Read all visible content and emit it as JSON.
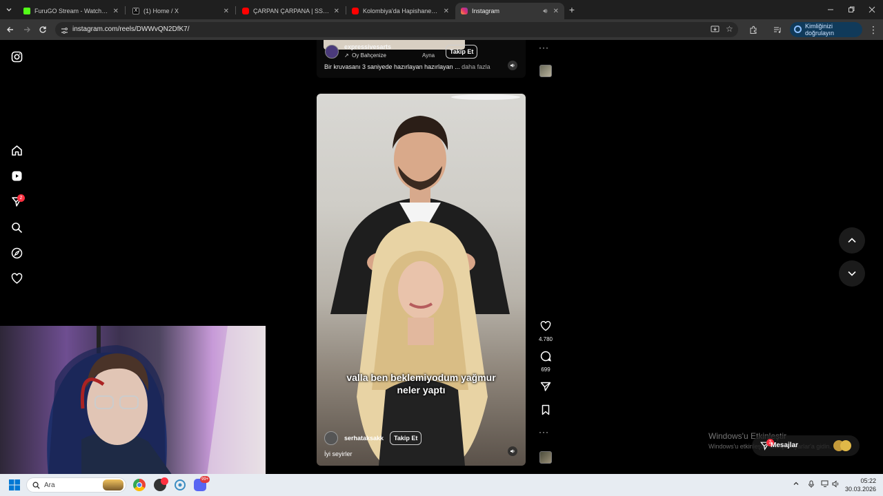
{
  "browser": {
    "tabs": [
      {
        "title": "FuruGO Stream - Watch Live on",
        "color": "#53fc18",
        "active": false
      },
      {
        "title": "(1) Home / X",
        "color": "#000000",
        "active": false
      },
      {
        "title": "ÇARPAN ÇARPANA | SSriders | E",
        "color": "#ff0000",
        "active": false
      },
      {
        "title": "Kolombiya'da Hapishane Baskın",
        "color": "#ff0000",
        "active": false
      },
      {
        "title": "Instagram",
        "color": "#e1306c",
        "active": true
      }
    ],
    "url": "instagram.com/reels/DWWvQN2DfK7/",
    "verify_label": "Kimliğinizi doğrulayın"
  },
  "sidebar": {
    "notification_count": "2"
  },
  "reel_top": {
    "username": "expressivesarts",
    "audio_label": "Oy Bahçenize",
    "audio_label_2": "Ayna",
    "follow_label": "Takip Et",
    "caption": "Bir kruvasanı 3 saniyede hazırlayan hazırlayan ...",
    "more_label": "daha fazla"
  },
  "reel_main": {
    "subtitle": "valla ben beklemiyodum yağmur neler yaptı",
    "username": "serhataksakk",
    "follow_label": "Takip Et",
    "caption": "İyi seyirler",
    "likes": "4.780",
    "comments": "699"
  },
  "overlay": {
    "windows_activate": "Windows'u Etkinleştir",
    "windows_activate_sub": "Windows'u etkinleştirmek için Ayarlar'a gidin.",
    "messages_label": "Mesajlar",
    "messages_count": "2"
  },
  "taskbar": {
    "search_placeholder": "Ara",
    "time": "05:22",
    "date": "30.03.2026",
    "discord_badge": "99+"
  },
  "colors": {
    "instagram_accent": "#ff3040",
    "verify_bg": "#103a5a"
  }
}
